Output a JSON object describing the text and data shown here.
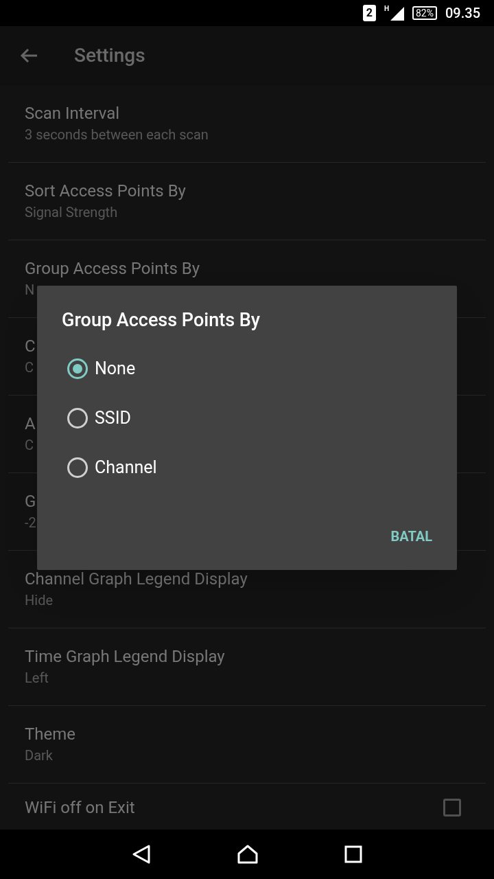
{
  "status_bar": {
    "sim": "2",
    "network": "H",
    "battery": "82%",
    "time": "09.35"
  },
  "toolbar": {
    "title": "Settings"
  },
  "settings": [
    {
      "kind": "text",
      "title": "Scan Interval",
      "summary": "3 seconds between each scan"
    },
    {
      "kind": "text",
      "title": "Sort Access Points By",
      "summary": "Signal Strength"
    },
    {
      "kind": "text",
      "title": "Group Access Points By",
      "summary": "N"
    },
    {
      "kind": "text",
      "title": "C",
      "summary": "C"
    },
    {
      "kind": "text",
      "title": "A",
      "summary": "C"
    },
    {
      "kind": "text",
      "title": "G",
      "summary": "-2"
    },
    {
      "kind": "text",
      "title": "Channel Graph Legend Display",
      "summary": "Hide"
    },
    {
      "kind": "text",
      "title": "Time Graph Legend Display",
      "summary": "Left"
    },
    {
      "kind": "text",
      "title": "Theme",
      "summary": "Dark"
    },
    {
      "kind": "checkbox",
      "title": "WiFi off on Exit",
      "checked": false
    }
  ],
  "dialog": {
    "title": "Group Access Points By",
    "options": [
      {
        "label": "None",
        "selected": true
      },
      {
        "label": "SSID",
        "selected": false
      },
      {
        "label": "Channel",
        "selected": false
      }
    ],
    "button": "BATAL"
  }
}
